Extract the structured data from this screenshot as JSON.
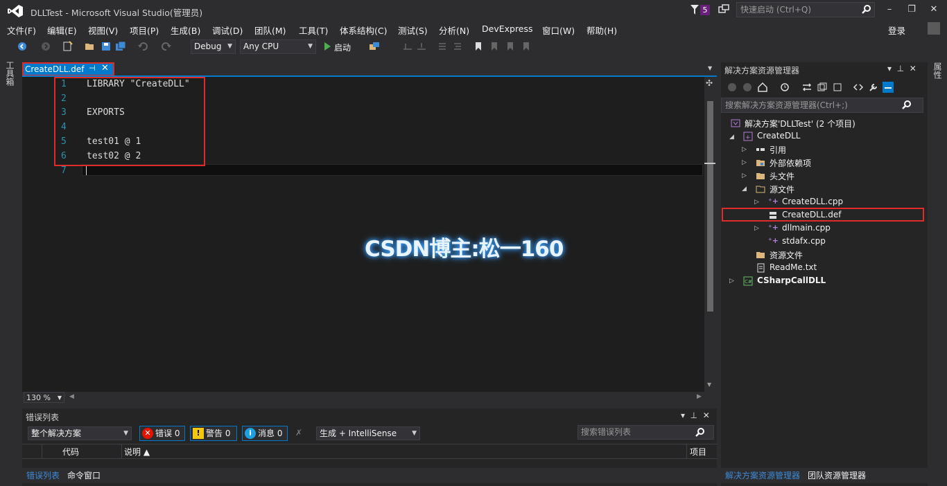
{
  "window": {
    "title": "DLLTest - Microsoft Visual Studio(管理员)",
    "notification_count": "5",
    "quick_launch_placeholder": "快速启动 (Ctrl+Q)",
    "minimize": "–",
    "maximize": "❐",
    "close": "✕"
  },
  "menu": {
    "items": [
      "文件(F)",
      "编辑(E)",
      "视图(V)",
      "项目(P)",
      "生成(B)",
      "调试(D)",
      "团队(M)",
      "工具(T)",
      "体系结构(C)",
      "测试(S)",
      "分析(N)",
      "DevExpress",
      "窗口(W)",
      "帮助(H)"
    ],
    "login": "登录"
  },
  "toolbar": {
    "configuration": "Debug",
    "platform": "Any CPU",
    "start_label": "启动"
  },
  "toolbox_label": "工具箱",
  "properties_label": "属性",
  "editor": {
    "tab_label": "CreateDLL.def",
    "zoom": "130 %",
    "lines": [
      {
        "num": "1",
        "text": "LIBRARY \"CreateDLL\""
      },
      {
        "num": "2",
        "text": ""
      },
      {
        "num": "3",
        "text": "EXPORTS"
      },
      {
        "num": "4",
        "text": ""
      },
      {
        "num": "5",
        "text": "test01 @ 1"
      },
      {
        "num": "6",
        "text": "test02 @ 2"
      },
      {
        "num": "7",
        "text": ""
      }
    ],
    "watermark": "CSDN博主:松一160"
  },
  "error_list": {
    "title": "错误列表",
    "scope": "整个解决方案",
    "errors_label": "错误 0",
    "warnings_label": "警告 0",
    "messages_label": "消息 0",
    "build_filter": "生成 + IntelliSense",
    "search_placeholder": "搜索错误列表",
    "columns": [
      "代码",
      "说明 ▲",
      "项目"
    ],
    "bottom_tabs": [
      "错误列表",
      "命令窗口"
    ]
  },
  "solution_explorer": {
    "title": "解决方案资源管理器",
    "search_placeholder": "搜索解决方案资源管理器(Ctrl+;)",
    "tree": [
      {
        "label": "解决方案'DLLTest' (2 个项目)",
        "icon": "solution-icon"
      },
      {
        "label": "CreateDLL",
        "icon": "cpp-project-icon"
      },
      {
        "label": "引用",
        "icon": "references-icon"
      },
      {
        "label": "外部依赖项",
        "icon": "external-deps-icon"
      },
      {
        "label": "头文件",
        "icon": "folder-icon"
      },
      {
        "label": "源文件",
        "icon": "folder-icon"
      },
      {
        "label": "CreateDLL.cpp",
        "icon": "cpp-file-icon"
      },
      {
        "label": "CreateDLL.def",
        "icon": "def-file-icon"
      },
      {
        "label": "dllmain.cpp",
        "icon": "cpp-file-icon"
      },
      {
        "label": "stdafx.cpp",
        "icon": "cpp-file-icon"
      },
      {
        "label": "资源文件",
        "icon": "folder-icon"
      },
      {
        "label": "ReadMe.txt",
        "icon": "text-file-icon"
      },
      {
        "label": "CSharpCallDLL",
        "icon": "csharp-project-icon"
      }
    ],
    "bottom_tabs": [
      "解决方案资源管理器",
      "团队资源管理器"
    ]
  },
  "colors": {
    "accent": "#007acc",
    "highlight_border": "#e02b2b",
    "line_number": "#2b91af",
    "editor_bg": "#1e1e1e"
  }
}
